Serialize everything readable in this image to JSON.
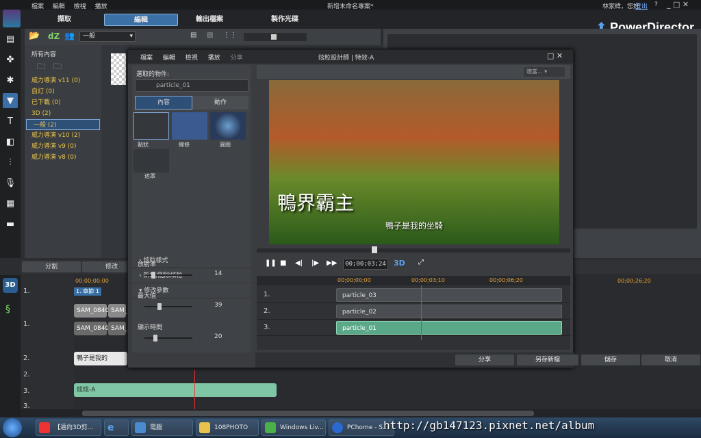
{
  "titlebar": {
    "menu": [
      "檔案",
      "編輯",
      "檢視",
      "播放"
    ],
    "project_title": "新增未命名專案*",
    "user": "林家緯，您好",
    "login": "登出",
    "help": "?",
    "brand": "PowerDirector"
  },
  "modes": [
    "擷取",
    "編輯",
    "輸出檔案",
    "製作光碟"
  ],
  "library": {
    "filter": "一般",
    "header": "所有內容",
    "items": [
      "威力導演 v11 (0)",
      "自訂 (0)",
      "已下載 (0)",
      "3D (2)",
      "一般 (2)",
      "威力導演 v10 (2)",
      "威力導演 v9 (0)",
      "威力導演 v8 (0)"
    ],
    "selected_index": 4
  },
  "timeline": {
    "buttons": [
      "分割",
      "修改"
    ],
    "times": [
      "00;00;00;00",
      "00;00;26;20"
    ],
    "chapter": "1. 章節 1",
    "clips": [
      "SAM_0840",
      "SAM_0840",
      "SAM_0840",
      "SAM_0840",
      "鴨子是我的",
      "炫炫-A"
    ],
    "track_numbers": [
      "1.",
      "1.",
      "2.",
      "2.",
      "3.",
      "3."
    ]
  },
  "dialog": {
    "menu": [
      "檔案",
      "編輯",
      "檢視",
      "播放",
      "分享"
    ],
    "title": "炫粒設計師 | 特效-A",
    "selected_object_label": "選取的物件:",
    "selected_object": "particle_01",
    "tabs": [
      "內容",
      "動作"
    ],
    "emitters": [
      "點狀",
      "線條",
      "圓圈",
      "遮罩"
    ],
    "sections": [
      "炫粒樣式",
      "新增/刪除炫粒",
      "修改參數"
    ],
    "params": [
      {
        "label": "放射率",
        "value": "14",
        "level": 0.15
      },
      {
        "label": "最大值",
        "value": "39",
        "level": 0.3
      },
      {
        "label": "顯示時間",
        "value": "20",
        "level": 0.2
      }
    ],
    "preview_title_text": "鴨界霸主",
    "preview_subtitle": "鴨子是我的坐騎",
    "timecode": "00;00;03;24",
    "view_3d": "3D",
    "zoom_label": "適當...",
    "track_times": [
      "00;00;00;00",
      "00;00;03;10",
      "00;00;06;20"
    ],
    "particles": [
      {
        "num": "1.",
        "name": "particle_03"
      },
      {
        "num": "2.",
        "name": "particle_02"
      },
      {
        "num": "3.",
        "name": "particle_01"
      }
    ],
    "footer": [
      "分享",
      "另存新檔",
      "儲存",
      "取消"
    ]
  },
  "taskbar": [
    "【邁向3D剪...",
    "電腦",
    "108PHOTO",
    "Windows Liv...",
    "PChome - S..."
  ],
  "watermark": "http://gb147123.pixnet.net/album",
  "colors": {
    "accent": "#3a70a5",
    "clip_green": "#7fc7a4",
    "folder_yellow": "#e7c34b"
  }
}
